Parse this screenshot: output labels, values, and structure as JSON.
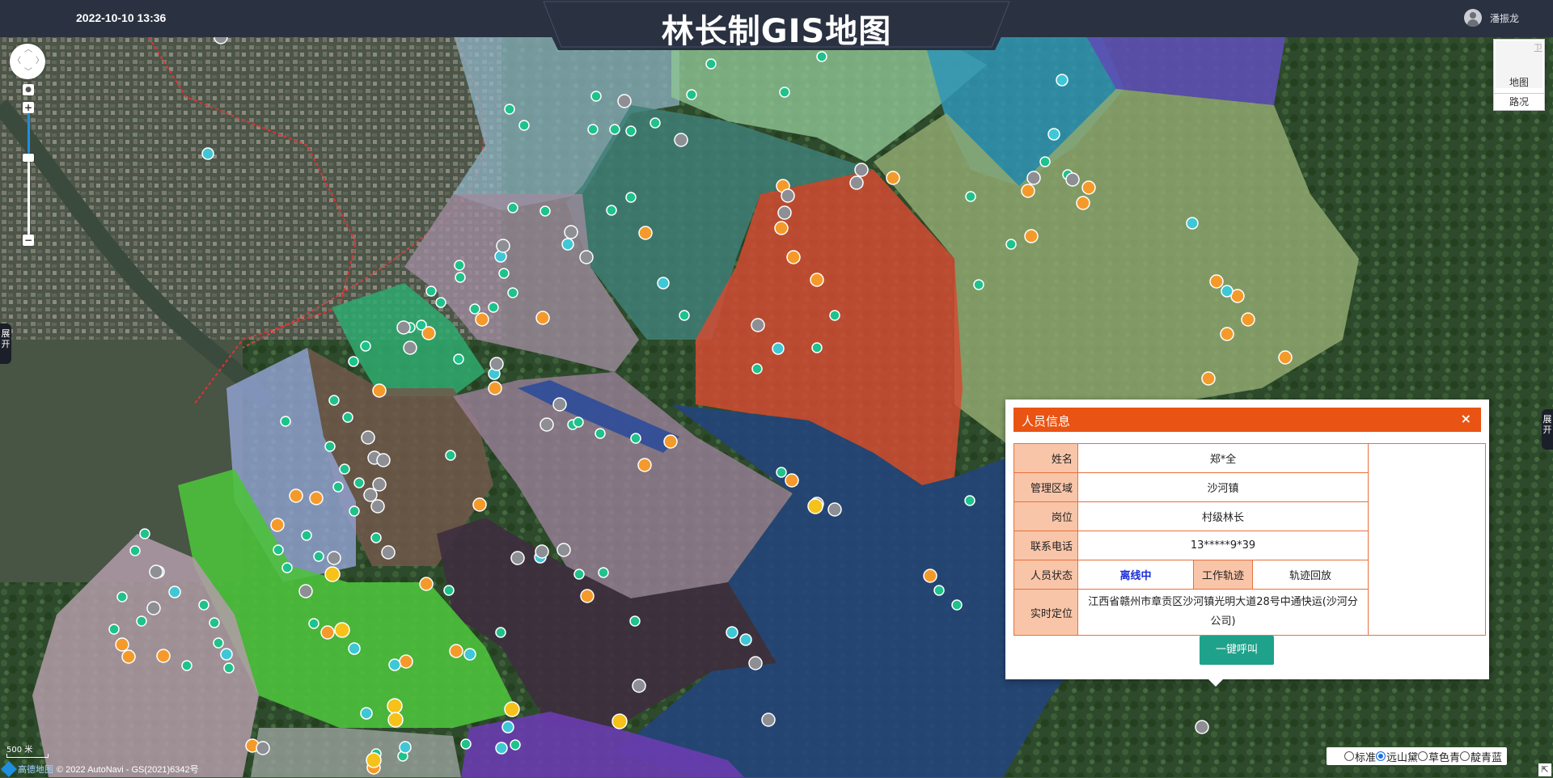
{
  "header": {
    "datetime": "2022-10-10 13:36",
    "title": "林长制GIS地图",
    "username": "潘振龙"
  },
  "map_controls": {
    "zoom_in": "+",
    "zoom_out": "−",
    "layer_label": "地图",
    "traffic_label": "路况",
    "layer_corner": "卫"
  },
  "side_tabs": {
    "left": "展开",
    "right": "展开"
  },
  "popup": {
    "title": "人员信息",
    "close": "×",
    "rows": {
      "name_label": "姓名",
      "name_value": "郑*全",
      "area_label": "管理区域",
      "area_value": "沙河镇",
      "post_label": "岗位",
      "post_value": "村级林长",
      "phone_label": "联系电话",
      "phone_value": "13*****9*39",
      "status_label": "人员状态",
      "status_value": "离线中",
      "track_label": "工作轨迹",
      "track_value": "轨迹回放",
      "location_label": "实时定位",
      "location_value": "江西省赣州市章贡区沙河镇光明大道28号中通快运(沙河分公司)"
    },
    "call_button": "一键呼叫"
  },
  "footer": {
    "scale": "500 米",
    "attribution_logo": "高德地图",
    "attribution": "© 2022 AutoNavi - GS(2021)6342号"
  },
  "map_styles": {
    "options": [
      "标准",
      "远山黛",
      "草色青",
      "靛青蓝"
    ],
    "selected": "远山黛"
  },
  "colors": {
    "header_bg": "#2a3140",
    "popup_header": "#e95313",
    "label_bg": "#f9c5a9",
    "call_button": "#1fa28b",
    "status_offline": "#1a2ed8"
  },
  "map_markers": {
    "orange": "orange forest-patrol marker",
    "green": "green tree marker",
    "cyan": "cyan facility marker",
    "grey": "grey person marker",
    "yellow": "yellow flag marker"
  }
}
